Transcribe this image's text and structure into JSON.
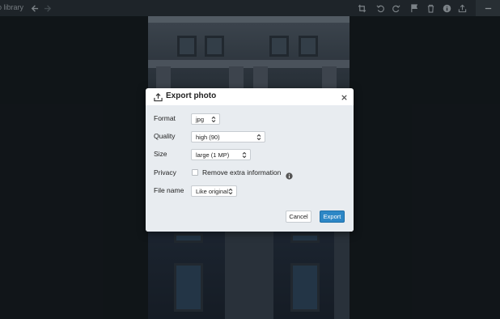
{
  "toolbar": {
    "title": "o library",
    "icons": [
      "arrow-left-icon",
      "arrow-right-icon",
      "crop-icon",
      "rotate-left-icon",
      "rotate-right-icon",
      "flag-icon",
      "trash-icon",
      "info-icon",
      "share-icon",
      "minimize-icon"
    ]
  },
  "dialog": {
    "title": "Export photo",
    "format": {
      "label": "Format",
      "value": "jpg"
    },
    "quality": {
      "label": "Quality",
      "value": "high (90)"
    },
    "size": {
      "label": "Size",
      "value": "large (1 MP)"
    },
    "privacy": {
      "label": "Privacy",
      "checkbox_label": "Remove extra information",
      "checked": false
    },
    "filename": {
      "label": "File name",
      "value": "Like original"
    },
    "cancel_label": "Cancel",
    "export_label": "Export"
  },
  "colors": {
    "accent": "#2d87c6",
    "toolbar_bg": "#2a3036",
    "page_bg": "#15191c",
    "dialog_body": "#e8ecf0"
  }
}
